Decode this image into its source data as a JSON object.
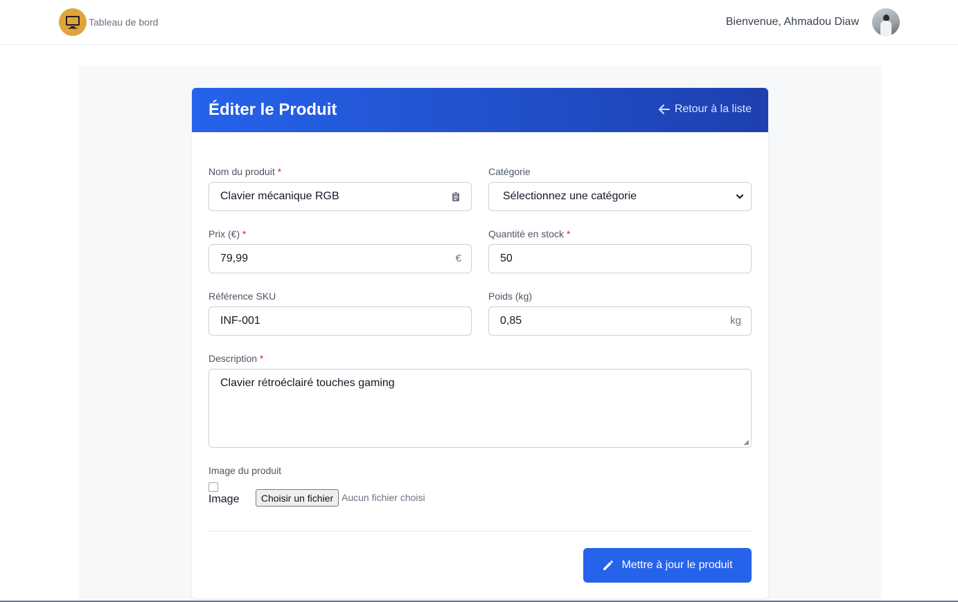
{
  "topbar": {
    "brand": "Tableau de bord",
    "welcome": "Bienvenue, Ahmadou Diaw",
    "logo_icon": "monitor-icon",
    "avatar_icon": "user-avatar"
  },
  "card": {
    "title": "Éditer le Produit",
    "back_label": "Retour à la liste",
    "header_gradient": [
      "#2563eb",
      "#1e40af"
    ]
  },
  "form": {
    "name": {
      "label": "Nom du produit",
      "required": "*",
      "value": "Clavier mécanique RGB",
      "icon": "clipboard-icon"
    },
    "category": {
      "label": "Catégorie",
      "value": "Sélectionnez une catégorie"
    },
    "price": {
      "label": "Prix (€)",
      "required": "*",
      "value": "79,99",
      "suffix": "€"
    },
    "stock": {
      "label": "Quantité en stock",
      "required": "*",
      "value": "50"
    },
    "sku": {
      "label": "Référence SKU",
      "value": "INF-001"
    },
    "weight": {
      "label": "Poids (kg)",
      "value": "0,85",
      "suffix": "kg"
    },
    "description": {
      "label": "Description",
      "required": "*",
      "value": "Clavier rétroéclairé touches gaming"
    },
    "image": {
      "label": "Image du produit",
      "alt": "Image",
      "file_button": "Choisir un fichier",
      "file_status": "Aucun fichier choisi"
    },
    "submit_label": "Mettre à jour le produit"
  },
  "colors": {
    "accent": "#2563eb",
    "required": "#dc2626"
  }
}
